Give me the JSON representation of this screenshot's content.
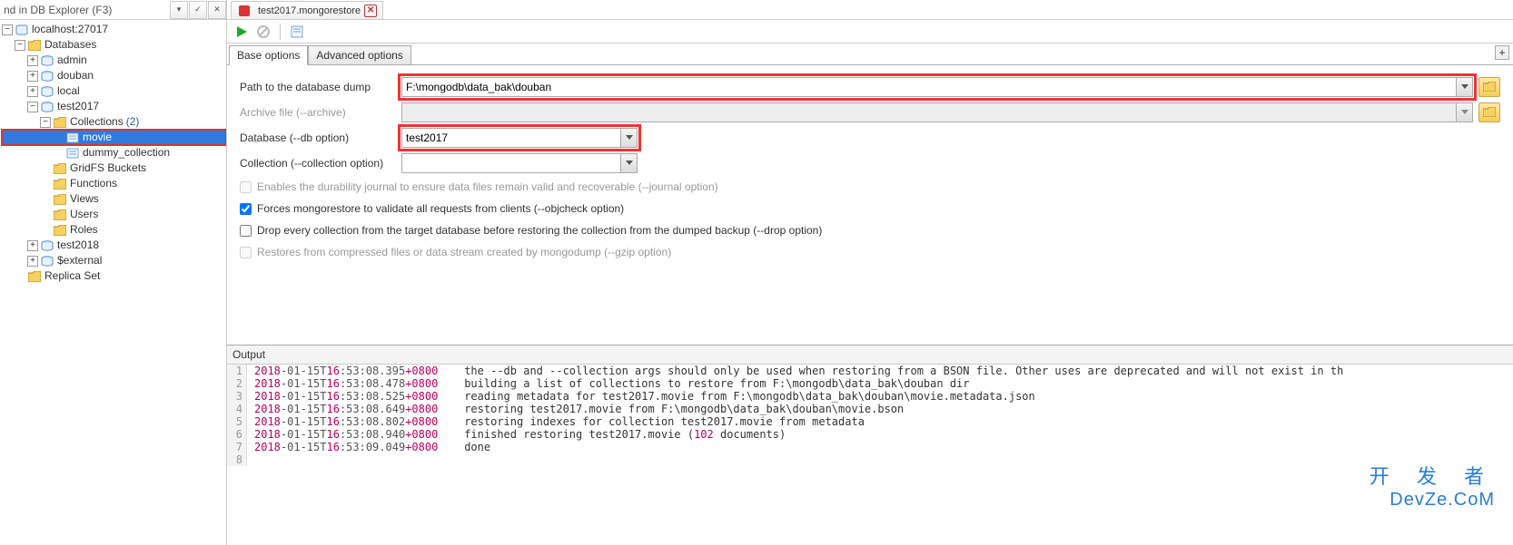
{
  "leftPanel": {
    "searchPlaceholder": "nd in DB Explorer (F3)",
    "host": "localhost:27017",
    "nodes": [
      {
        "label": "Databases",
        "type": "folder",
        "depth": 1,
        "expanded": true
      },
      {
        "label": "admin",
        "type": "db",
        "depth": 2,
        "expanded": false
      },
      {
        "label": "douban",
        "type": "db",
        "depth": 2,
        "expanded": false
      },
      {
        "label": "local",
        "type": "db",
        "depth": 2,
        "expanded": false
      },
      {
        "label": "test2017",
        "type": "db",
        "depth": 2,
        "expanded": true
      },
      {
        "label": "Collections",
        "count": "(2)",
        "type": "folder",
        "depth": 3,
        "expanded": true
      },
      {
        "label": "movie",
        "type": "coll",
        "depth": 4,
        "selected": true
      },
      {
        "label": "dummy_collection",
        "type": "coll",
        "depth": 4
      },
      {
        "label": "GridFS Buckets",
        "type": "folder",
        "depth": 3
      },
      {
        "label": "Functions",
        "type": "folder",
        "depth": 3
      },
      {
        "label": "Views",
        "type": "folder",
        "depth": 3
      },
      {
        "label": "Users",
        "type": "folder",
        "depth": 3
      },
      {
        "label": "Roles",
        "type": "folder",
        "depth": 3
      },
      {
        "label": "test2018",
        "type": "db",
        "depth": 2,
        "expanded": false
      },
      {
        "label": "$external",
        "type": "db",
        "depth": 2,
        "expanded": false
      },
      {
        "label": "Replica Set",
        "type": "folder",
        "depth": 1
      }
    ]
  },
  "tab": {
    "title": "test2017.mongorestore"
  },
  "optionTabs": {
    "base": "Base options",
    "advanced": "Advanced options"
  },
  "form": {
    "pathLabel": "Path to the database dump",
    "pathValue": "F:\\mongodb\\data_bak\\douban",
    "archiveLabel": "Archive file (--archive)",
    "dbLabel": "Database (--db option)",
    "dbValue": "test2017",
    "collLabel": "Collection (--collection option)",
    "collValue": "",
    "chk1": "Enables the durability journal to ensure data files remain valid and recoverable (--journal option)",
    "chk2": "Forces mongorestore to validate all requests from clients (--objcheck option)",
    "chk3": "Drop every collection from the target database before restoring the collection from the dumped backup (--drop option)",
    "chk4": "Restores from compressed files or data stream created by mongodump (--gzip option)"
  },
  "output": {
    "title": "Output",
    "lines": [
      {
        "n": "1",
        "ts": "2018-01-15T16:53:08.395+0800",
        "msg": "the --db and --collection args should only be used when restoring from a BSON file. Other uses are deprecated and will not exist in th"
      },
      {
        "n": "2",
        "ts": "2018-01-15T16:53:08.478+0800",
        "msg": "building a list of collections to restore from F:\\mongodb\\data_bak\\douban dir"
      },
      {
        "n": "3",
        "ts": "2018-01-15T16:53:08.525+0800",
        "msg": "reading metadata for test2017.movie from F:\\mongodb\\data_bak\\douban\\movie.metadata.json"
      },
      {
        "n": "4",
        "ts": "2018-01-15T16:53:08.649+0800",
        "msg": "restoring test2017.movie from F:\\mongodb\\data_bak\\douban\\movie.bson"
      },
      {
        "n": "5",
        "ts": "2018-01-15T16:53:08.802+0800",
        "msg": "restoring indexes for collection test2017.movie from metadata"
      },
      {
        "n": "6",
        "ts": "2018-01-15T16:53:08.940+0800",
        "msg": "finished restoring test2017.movie (102 documents)",
        "num": "102"
      },
      {
        "n": "7",
        "ts": "2018-01-15T16:53:09.049+0800",
        "msg": "done"
      },
      {
        "n": "8",
        "ts": "",
        "msg": ""
      }
    ]
  },
  "watermark": {
    "line1": "开 发 者",
    "line2": "DevZe.CoM"
  }
}
